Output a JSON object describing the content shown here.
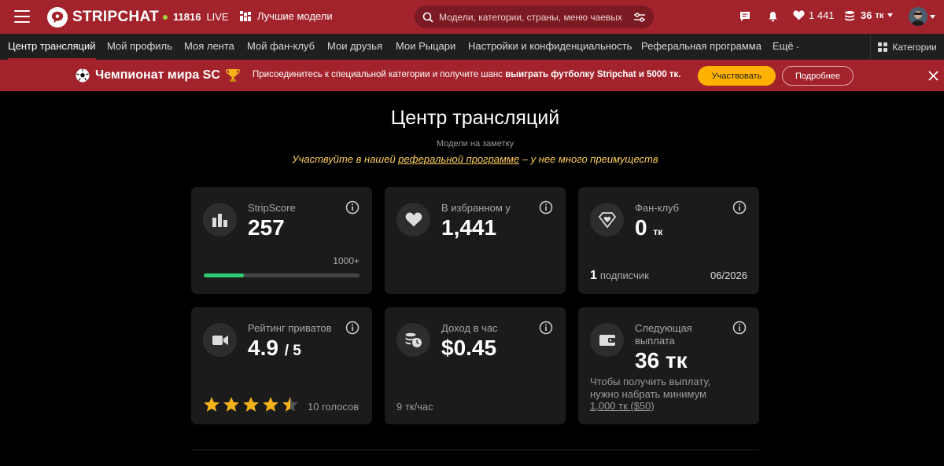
{
  "header": {
    "logo_text": "STRIPCHAT",
    "live_count": "11816",
    "live_label": "LIVE",
    "best_models": "Лучшие модели",
    "search_placeholder": "Модели, категории, страны, меню чаевых",
    "favorites_count": "1 441",
    "tokens": "36",
    "tokens_unit": "тк"
  },
  "nav": {
    "items": [
      "Центр трансляций",
      "Мой профиль",
      "Моя лента",
      "Мой фан-клуб",
      "Мои друзья",
      "Мои Рыцари",
      "Настройки и конфиденциальность",
      "Реферальная программа",
      "Ещё"
    ],
    "categories": "Категории"
  },
  "banner": {
    "title": "Чемпионат мира SC",
    "text_before": "Присоединитесь к специальной категории и получите шанс ",
    "text_bold": "выиграть футболку Stripchat и 5000 тк.",
    "join_button": "Участвовать",
    "more_button": "Подробнее"
  },
  "main": {
    "title": "Центр трансляций",
    "subtitle": "Модели на заметку",
    "promo_before": "Участвуйте в нашей ",
    "promo_link": "реферальной программе",
    "promo_after": " – у нее много преимуществ"
  },
  "cards": {
    "stripscore": {
      "label": "StripScore",
      "value": "257",
      "target": "1000+",
      "progress": 0.257
    },
    "favorites": {
      "label": "В избранном у",
      "value": "1,441"
    },
    "fanclub": {
      "label": "Фан-клуб",
      "value": "0",
      "unit": "тк",
      "subscribers_count": "1",
      "subscribers_label": "подписчик",
      "date": "06/2026"
    },
    "rating": {
      "label": "Рейтинг приватов",
      "value": "4.9",
      "max": "/ 5",
      "stars": 4.5,
      "votes": "10 голосов"
    },
    "income": {
      "label": "Доход в час",
      "value": "$0.45",
      "rate": "9 тк/час"
    },
    "payout": {
      "label_line1": "Следующая",
      "label_line2": "выплата",
      "value": "36 тк",
      "note_line1": "Чтобы получить выплату,",
      "note_line2": "нужно набрать минимум",
      "min_link": "1,000 тк ($50)"
    }
  },
  "colors": {
    "brand": "#a3232c",
    "accent": "#ffb300",
    "progress": "#2ecc71",
    "promo": "#ffcf5c",
    "card_bg": "#1b1b1b"
  }
}
